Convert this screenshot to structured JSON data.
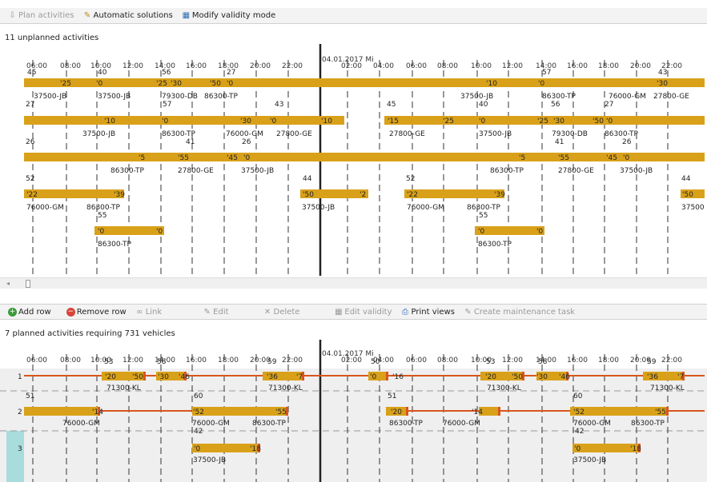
{
  "toolbar_top": {
    "plan": "Plan activities",
    "auto": "Automatic solutions",
    "modify": "Modify validity mode"
  },
  "top_panel": {
    "title": "11 unplanned activities",
    "date_label": "04.01.2017 Mi"
  },
  "toolbar_bottom": {
    "add_row": "Add row",
    "remove_row": "Remove row",
    "link": "Link",
    "edit": "Edit",
    "delete": "Delete",
    "edit_validity": "Edit validity",
    "print_views": "Print views",
    "create_task": "Create maintenance task"
  },
  "bottom_panel": {
    "title": "7 planned activities requiring 731 vehicles",
    "date_label": "04.01.2017 Mi"
  },
  "hours_day1": [
    "06:00",
    "08:00",
    "10:00",
    "12:00",
    "14:00",
    "16:00",
    "18:00",
    "20:00",
    "22:00"
  ],
  "hours_day2": [
    "02:00",
    "04:00",
    "06:00",
    "08:00",
    "10:00",
    "12:00",
    "14:00",
    "16:00",
    "18:00",
    "20:00",
    "22:00"
  ],
  "top_row_nums": [
    "45",
    "40",
    "56",
    "27",
    "57",
    "43"
  ],
  "bottom_row_nums": [
    "53",
    "58",
    "59",
    "50",
    "53",
    "58",
    "59"
  ],
  "colors": {
    "bar": "#d9a11a",
    "line": "#d9551c",
    "row_bg": "#efefef",
    "selected": "#a9dcdc"
  },
  "rows_top": [
    {
      "bars": [
        [
          30,
          880
        ]
      ],
      "labels": [
        [
          "'25",
          75
        ],
        [
          "'0",
          120
        ],
        [
          "'25",
          195
        ],
        [
          "'30",
          213
        ],
        [
          "'50",
          262
        ],
        [
          "'0",
          283
        ],
        [
          "'10",
          607
        ],
        [
          "'0",
          672
        ],
        [
          "'30",
          820
        ]
      ],
      "stations": [
        [
          "37500-JB",
          42
        ],
        [
          "37500-JB",
          122
        ],
        [
          "79300-DB",
          202
        ],
        [
          "86300-TP",
          255
        ],
        [
          "37500-JB",
          575
        ],
        [
          "86300-TP",
          677
        ],
        [
          "76000-GM",
          760
        ],
        [
          "27800-GE",
          816
        ]
      ],
      "nums": [
        [
          "27",
          32
        ],
        [
          "57",
          203
        ],
        [
          "43",
          343
        ],
        [
          "45",
          483
        ],
        [
          "40",
          598
        ],
        [
          "56",
          688
        ],
        [
          "27",
          755
        ]
      ]
    },
    {
      "bars": [
        [
          30,
          430
        ],
        [
          480,
          880
        ]
      ],
      "labels": [
        [
          "'10",
          130
        ],
        [
          "'0",
          202
        ],
        [
          "'30",
          300
        ],
        [
          "'0",
          337
        ],
        [
          "'10",
          401
        ],
        [
          "'15",
          484
        ],
        [
          "'25",
          553
        ],
        [
          "'0",
          598
        ],
        [
          "'25",
          671
        ],
        [
          "'30",
          691
        ],
        [
          "'50",
          740
        ],
        [
          "'0",
          757
        ]
      ],
      "stations": [
        [
          "37500-JB",
          103
        ],
        [
          "86300-TP",
          202
        ],
        [
          "76000-GM",
          282
        ],
        [
          "27800-GE",
          345
        ],
        [
          "27800-GE",
          486
        ],
        [
          "37500-JB",
          598
        ],
        [
          "79300-DB",
          689
        ],
        [
          "86300-TP",
          755
        ]
      ],
      "nums": [
        [
          "26",
          32
        ],
        [
          "41",
          232
        ],
        [
          "26",
          302
        ],
        [
          "41",
          693
        ],
        [
          "26",
          777
        ]
      ]
    },
    {
      "bars": [
        [
          30,
          880
        ]
      ],
      "labels": [
        [
          "'5",
          173
        ],
        [
          "'55",
          222
        ],
        [
          "'45",
          283
        ],
        [
          "'0",
          304
        ],
        [
          "'5",
          648
        ],
        [
          "'55",
          697
        ],
        [
          "'45",
          757
        ],
        [
          "'0",
          778
        ]
      ],
      "stations": [
        [
          "86300-TP",
          138
        ],
        [
          "27800-GE",
          222
        ],
        [
          "37500-JB",
          301
        ],
        [
          "86300-TP",
          612
        ],
        [
          "27800-GE",
          697
        ],
        [
          "37500-JB",
          774
        ]
      ],
      "nums": [
        [
          "52",
          32
        ],
        [
          "44",
          378
        ],
        [
          "52",
          507
        ],
        [
          "44",
          851
        ]
      ]
    },
    {
      "bars": [
        [
          30,
          155
        ],
        [
          375,
          460
        ],
        [
          505,
          630
        ],
        [
          850,
          880
        ]
      ],
      "labels": [
        [
          "'22",
          33
        ],
        [
          "'39",
          142
        ],
        [
          "'50",
          378
        ],
        [
          "'2",
          449
        ],
        [
          "'22",
          508
        ],
        [
          "'39",
          617
        ],
        [
          "'50",
          852
        ]
      ],
      "stations": [
        [
          "76000-GM",
          33
        ],
        [
          "86300-TP",
          108
        ],
        [
          "37500-JB",
          377
        ],
        [
          "76000-GM",
          508
        ],
        [
          "86300-TP",
          583
        ],
        [
          "37500",
          851
        ]
      ],
      "nums": [
        [
          "55",
          122
        ],
        [
          "55",
          598
        ]
      ]
    },
    {
      "bars": [
        [
          118,
          205
        ],
        [
          593,
          680
        ]
      ],
      "labels": [
        [
          "'0",
          122
        ],
        [
          "'0",
          195
        ],
        [
          "'0",
          597
        ],
        [
          "'0",
          670
        ]
      ],
      "stations": [
        [
          "86300-TP",
          122
        ],
        [
          "86300-TP",
          597
        ]
      ],
      "nums": []
    }
  ],
  "rows_bottom": [
    {
      "num": "1",
      "line": [
        30,
        880
      ],
      "bars": [
        [
          127,
          182
        ],
        [
          195,
          233
        ],
        [
          328,
          380
        ],
        [
          460,
          485
        ],
        [
          600,
          655
        ],
        [
          670,
          710
        ],
        [
          803,
          855
        ]
      ],
      "labels": [
        [
          "'20",
          131
        ],
        [
          "'50",
          165
        ],
        [
          "'30",
          197
        ],
        [
          "'46",
          223
        ],
        [
          "'36",
          333
        ],
        [
          "'7",
          370
        ],
        [
          "'0",
          462
        ],
        [
          "'16",
          490
        ],
        [
          "'20",
          606
        ],
        [
          "'50",
          639
        ],
        [
          "'30",
          670
        ],
        [
          "'46",
          698
        ],
        [
          "'36",
          808
        ],
        [
          "'7",
          846
        ]
      ],
      "stations": [
        [
          "71300-KL",
          133
        ],
        [
          "71300-KL",
          335
        ],
        [
          "71300-KL",
          608
        ],
        [
          "71300-KL",
          812
        ]
      ],
      "nums": [
        [
          "51",
          32
        ],
        [
          "60",
          242
        ],
        [
          "51",
          484
        ],
        [
          "60",
          716
        ]
      ]
    },
    {
      "num": "2",
      "line": [
        30,
        360
      ],
      "line2": [
        482,
        880
      ],
      "bars": [
        [
          30,
          125
        ],
        [
          240,
          360
        ],
        [
          482,
          510
        ],
        [
          598,
          625
        ],
        [
          712,
          835
        ]
      ],
      "labels": [
        [
          "'14",
          115
        ],
        [
          "'52",
          241
        ],
        [
          "'55",
          344
        ],
        [
          "'20",
          488
        ],
        [
          "'14",
          589
        ],
        [
          "'52",
          716
        ],
        [
          "'55",
          818
        ]
      ],
      "stations": [
        [
          "76000-GM",
          78
        ],
        [
          "76000-GM",
          240
        ],
        [
          "86300-TP",
          315
        ],
        [
          "86300-TP",
          486
        ],
        [
          "76000-GM",
          553
        ],
        [
          "76000-GM",
          716
        ],
        [
          "86300-TP",
          788
        ]
      ],
      "nums": [
        [
          "42",
          242
        ],
        [
          "42",
          718
        ]
      ]
    },
    {
      "num": "3",
      "line": null,
      "bars": [
        [
          240,
          325
        ],
        [
          715,
          800
        ]
      ],
      "labels": [
        [
          "'0",
          242
        ],
        [
          "'18",
          312
        ],
        [
          "'0",
          717
        ],
        [
          "'18",
          787
        ]
      ],
      "stations": [
        [
          "37500-JB",
          241
        ],
        [
          "37500-JB",
          716
        ]
      ],
      "nums": []
    }
  ]
}
